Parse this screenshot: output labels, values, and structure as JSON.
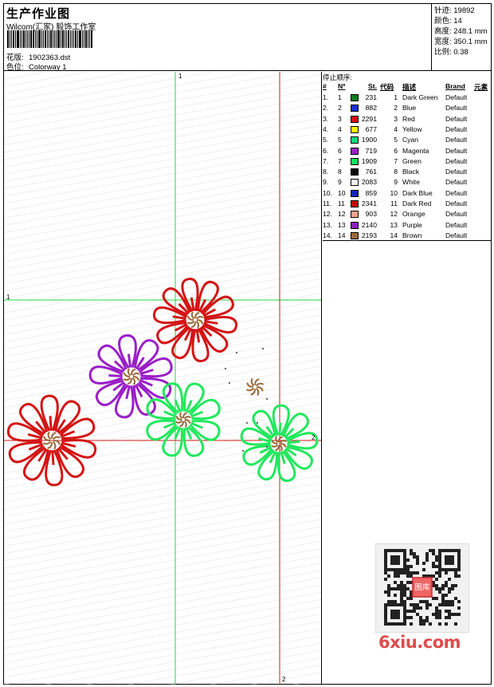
{
  "header": {
    "title": "生产作业图",
    "company": "Wilcom(汇家) 毅饰工作室",
    "file_label": "花版:",
    "file_value": "1902363.dst",
    "colorway_label": "色位:",
    "colorway_value": "Colorway 1"
  },
  "stats": {
    "stitches": "针迹: 19892",
    "colors": "颜色: 14",
    "height": "高度: 248.1 mm",
    "width": "宽度: 350.1 mm",
    "scale": "比例: 0.38"
  },
  "axes": {
    "green_top": "1",
    "green_left": "1",
    "red_right": "2",
    "red_bottom": "2"
  },
  "stops": {
    "title": "停止顺序:",
    "headers": {
      "idx": "#",
      "no": "Nº",
      "st": "St.",
      "code": "代码",
      "desc": "描述",
      "brand": "Brand",
      "elem": "元素"
    },
    "rows": [
      {
        "idx": "1.",
        "no": "1",
        "color": "#0b7a1f",
        "st": "231",
        "code": "1",
        "desc": "Dark Green",
        "brand": "Default"
      },
      {
        "idx": "2.",
        "no": "2",
        "color": "#1a2fd0",
        "st": "882",
        "code": "2",
        "desc": "Blue",
        "brand": "Default"
      },
      {
        "idx": "3.",
        "no": "3",
        "color": "#d10f0f",
        "st": "2291",
        "code": "3",
        "desc": "Red",
        "brand": "Default"
      },
      {
        "idx": "4.",
        "no": "4",
        "color": "#f5f500",
        "st": "677",
        "code": "4",
        "desc": "Yellow",
        "brand": "Default"
      },
      {
        "idx": "5.",
        "no": "5",
        "color": "#15d67a",
        "st": "1900",
        "code": "5",
        "desc": "Cyan",
        "brand": "Default"
      },
      {
        "idx": "6.",
        "no": "6",
        "color": "#9b1fbf",
        "st": "719",
        "code": "6",
        "desc": "Magenta",
        "brand": "Default"
      },
      {
        "idx": "7.",
        "no": "7",
        "color": "#17e05a",
        "st": "1909",
        "code": "7",
        "desc": "Green",
        "brand": "Default"
      },
      {
        "idx": "8.",
        "no": "8",
        "color": "#0a0a0a",
        "st": "761",
        "code": "8",
        "desc": "Black",
        "brand": "Default"
      },
      {
        "idx": "9.",
        "no": "9",
        "color": "#f2f2f2",
        "st": "2083",
        "code": "9",
        "desc": "White",
        "brand": "Default"
      },
      {
        "idx": "10.",
        "no": "10",
        "color": "#1028b8",
        "st": "859",
        "code": "10",
        "desc": "Dark Blue",
        "brand": "Default"
      },
      {
        "idx": "11.",
        "no": "11",
        "color": "#c00a0a",
        "st": "2341",
        "code": "11",
        "desc": "Dark Red",
        "brand": "Default"
      },
      {
        "idx": "12.",
        "no": "12",
        "color": "#f4a08a",
        "st": "903",
        "code": "12",
        "desc": "Orange",
        "brand": "Default"
      },
      {
        "idx": "13.",
        "no": "13",
        "color": "#8e1fc0",
        "st": "2140",
        "code": "13",
        "desc": "Purple",
        "brand": "Default"
      },
      {
        "idx": "14.",
        "no": "14",
        "color": "#9b6a3a",
        "st": "2193",
        "code": "14",
        "desc": "Brown",
        "brand": "Default"
      }
    ]
  },
  "watermark": {
    "brand": "6xiu.com",
    "stamp": "图库"
  },
  "colors": {
    "guide_green": "#22d84a",
    "guide_red": "#d41a1a",
    "flower_red": "#d41515",
    "flower_purple": "#9a1fc8",
    "flower_green": "#22e85e",
    "center_brown": "#9b6a3a"
  }
}
